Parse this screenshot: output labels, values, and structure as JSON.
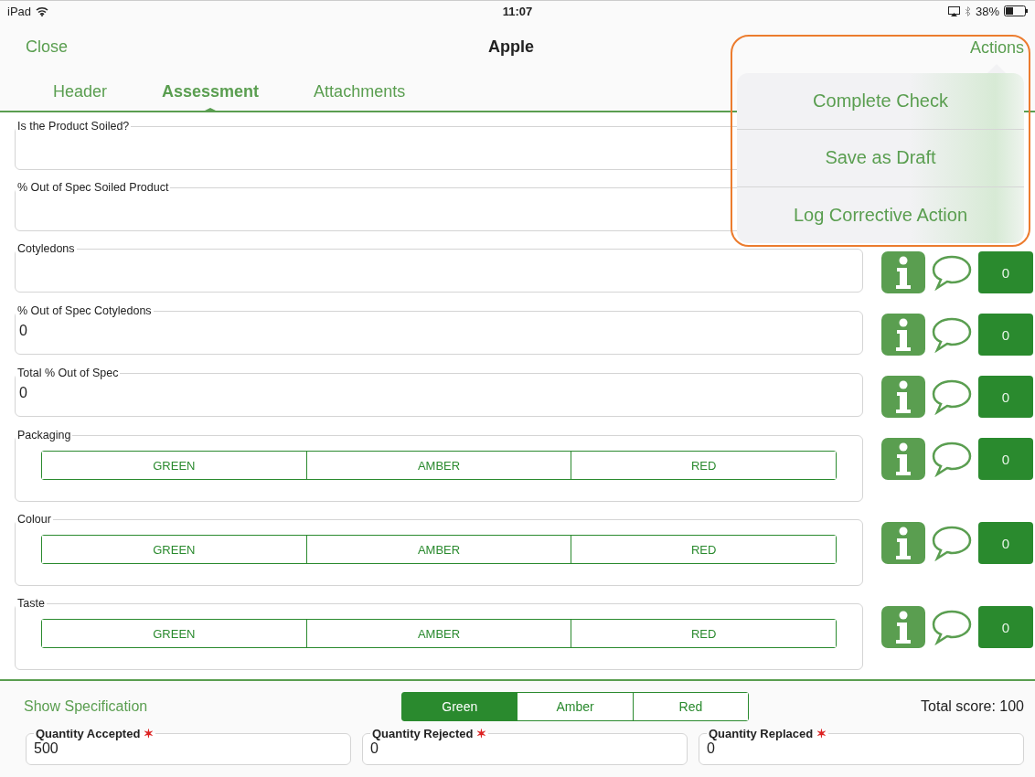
{
  "status_bar": {
    "device": "iPad",
    "time": "11:07",
    "battery": "38%"
  },
  "nav": {
    "close": "Close",
    "title": "Apple",
    "actions": "Actions"
  },
  "tabs": [
    {
      "label": "Header",
      "selected": false
    },
    {
      "label": "Assessment",
      "selected": true
    },
    {
      "label": "Attachments",
      "selected": false
    }
  ],
  "fields": [
    {
      "kind": "text",
      "label": "Is the Product Soiled?"
    },
    {
      "kind": "text",
      "label": "% Out of Spec Soiled Product"
    },
    {
      "kind": "text",
      "label": "Cotyledons",
      "count": "0"
    },
    {
      "kind": "text",
      "label": "% Out of Spec Cotyledons",
      "value": "0",
      "count": "0"
    },
    {
      "kind": "text",
      "label": "Total % Out of Spec",
      "value": "0",
      "count": "0"
    },
    {
      "kind": "rag",
      "label": "Packaging",
      "options": [
        {
          "label": "GREEN",
          "selected": false
        },
        {
          "label": "AMBER",
          "selected": false
        },
        {
          "label": "RED",
          "selected": false
        }
      ],
      "count": "0"
    },
    {
      "kind": "rag",
      "label": "Colour",
      "options": [
        {
          "label": "GREEN",
          "selected": false
        },
        {
          "label": "AMBER",
          "selected": false
        },
        {
          "label": "RED",
          "selected": false
        }
      ],
      "count": "0"
    },
    {
      "kind": "rag",
      "label": "Taste",
      "options": [
        {
          "label": "GREEN",
          "selected": false
        },
        {
          "label": "AMBER",
          "selected": false
        },
        {
          "label": "RED",
          "selected": false
        }
      ],
      "count": "0"
    }
  ],
  "actions_menu": {
    "items": [
      "Complete Check",
      "Save as Draft",
      "Log Corrective Action"
    ]
  },
  "footer": {
    "show_specification": "Show Specification",
    "rating": [
      {
        "label": "Green",
        "selected": true
      },
      {
        "label": "Amber",
        "selected": false
      },
      {
        "label": "Red",
        "selected": false
      }
    ],
    "total_score": "Total score: 100",
    "quantities": [
      {
        "label": "Quantity Accepted",
        "required_mark": "✶",
        "value": "500"
      },
      {
        "label": "Quantity Rejected",
        "required_mark": "✶",
        "value": "0"
      },
      {
        "label": "Quantity Replaced",
        "required_mark": "✶",
        "value": "0"
      }
    ]
  }
}
